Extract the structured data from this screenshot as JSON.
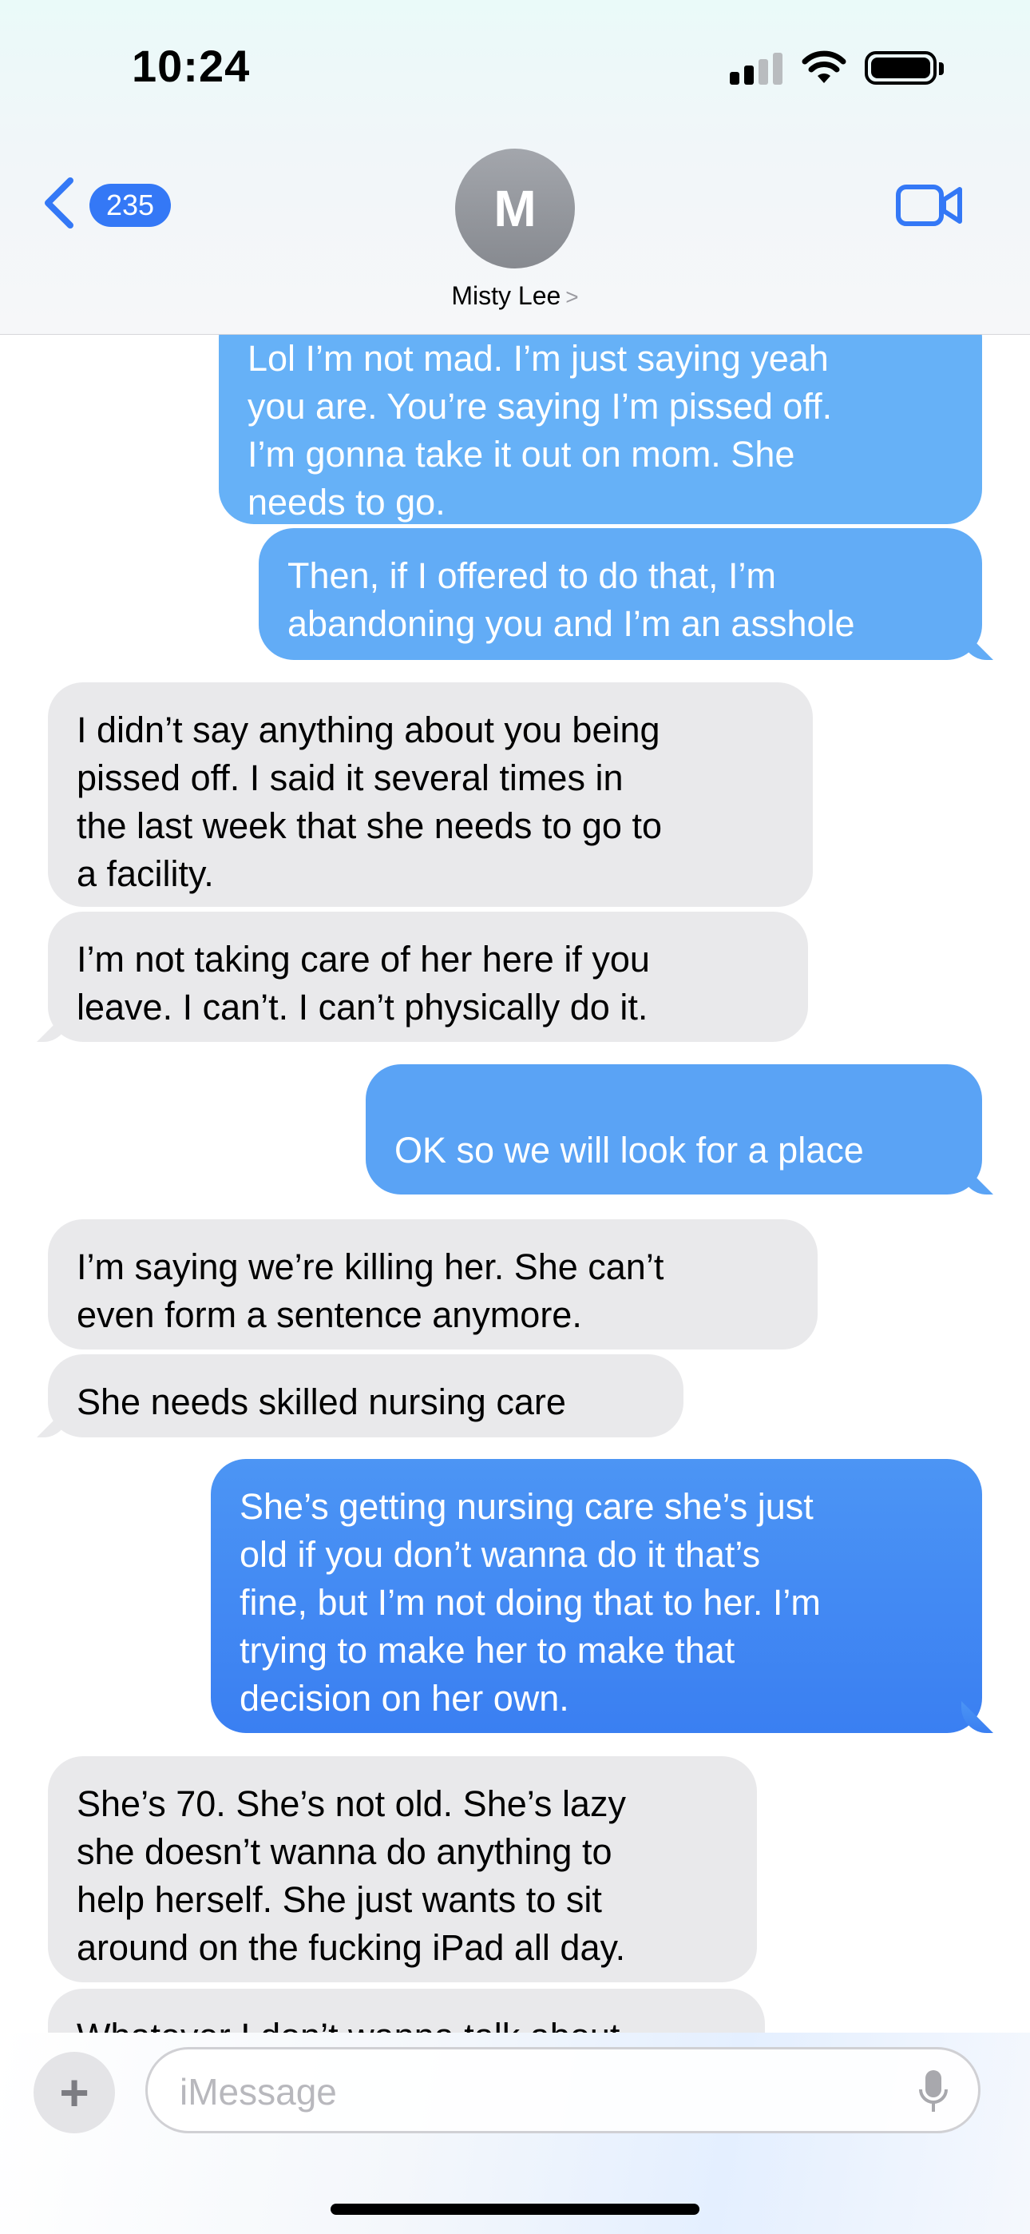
{
  "status_bar": {
    "time": "10:24"
  },
  "header": {
    "back_count": "235",
    "avatar_initial": "M",
    "contact_name": "Misty Lee",
    "contact_chevron": ">"
  },
  "messages": [
    {
      "dir": "out",
      "text": "Lol I’m not mad. I’m just saying yeah\nyou are. You’re saying I’m pissed off.\nI’m gonna take it out on mom. She\nneeds to go."
    },
    {
      "dir": "out",
      "text": "Then, if I offered to do that, I’m\nabandoning you and I’m an asshole"
    },
    {
      "dir": "in",
      "text": "I didn’t say anything about you being\npissed off. I said it several times in\nthe last week that she needs to go to\na facility."
    },
    {
      "dir": "in",
      "text": "I’m not  taking care of her here if you\nleave. I can’t. I can’t physically do it."
    },
    {
      "dir": "out",
      "text": "OK so we will look for a place"
    },
    {
      "dir": "in",
      "text": "I’m saying we’re killing her. She can’t\neven form a sentence anymore."
    },
    {
      "dir": "in",
      "text": "She needs skilled nursing care"
    },
    {
      "dir": "out",
      "text": "She’s getting nursing care she’s just\nold if you don’t wanna do it that’s\nfine, but I’m not doing that to her. I’m\ntrying to make her to make that\ndecision on her own."
    },
    {
      "dir": "in",
      "text": "She’s 70. She’s not old. She’s lazy\nshe doesn’t wanna do anything to\nhelp herself. She just wants to sit\naround on the fucking iPad all day."
    },
    {
      "dir": "in",
      "text": "Whatever I don’t wanna talk about"
    }
  ],
  "input": {
    "placeholder": "iMessage",
    "plus_glyph": "+"
  },
  "colors": {
    "outgoing_top": "#6fb6f8",
    "outgoing_bottom": "#3a7ff2",
    "incoming": "#e9e9eb",
    "accent": "#3478f6"
  },
  "icons": [
    "signal-icon",
    "wifi-icon",
    "battery-icon",
    "back-chevron-icon",
    "video-call-icon",
    "plus-icon",
    "microphone-icon"
  ]
}
